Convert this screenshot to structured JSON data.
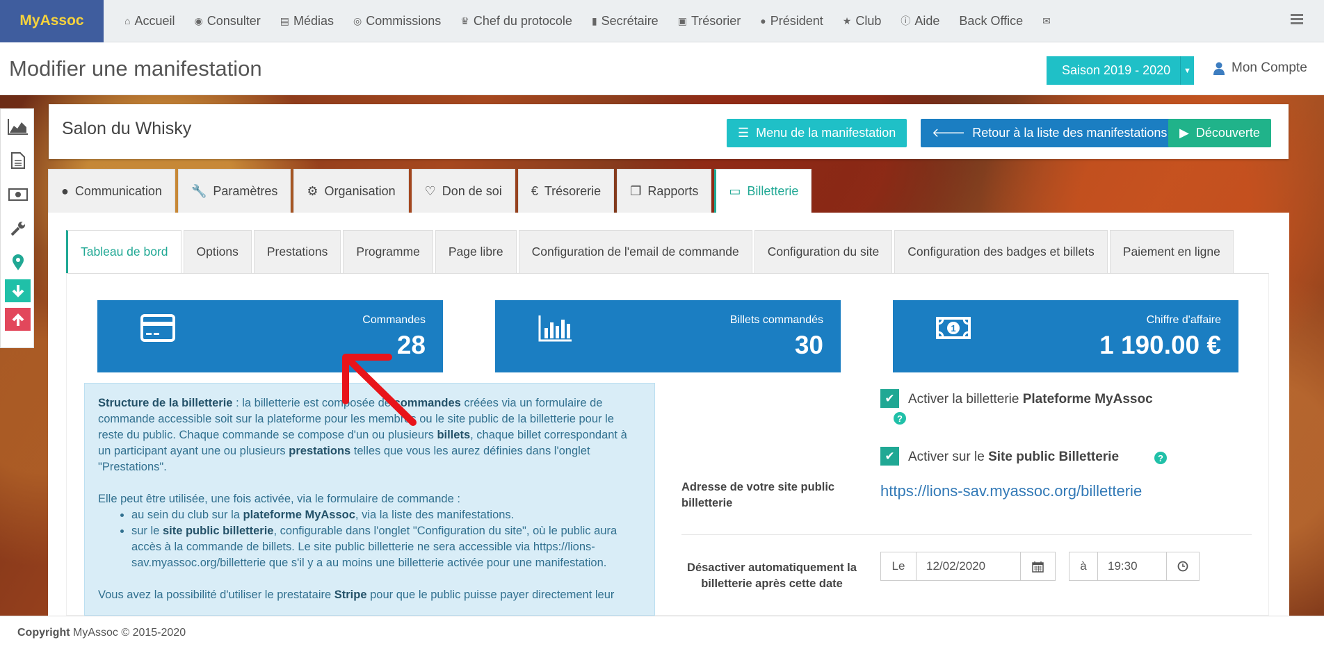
{
  "brand": "MyAssoc",
  "nav": [
    {
      "label": "Accueil",
      "icon": "home-icon",
      "glyph": "⌂"
    },
    {
      "label": "Consulter",
      "icon": "eye-icon",
      "glyph": "◉"
    },
    {
      "label": "Médias",
      "icon": "file-icon",
      "glyph": "▤"
    },
    {
      "label": "Commissions",
      "icon": "user-circle-icon",
      "glyph": "◎"
    },
    {
      "label": "Chef du protocole",
      "icon": "trophy-icon",
      "glyph": "♛"
    },
    {
      "label": "Secrétaire",
      "icon": "book-icon",
      "glyph": "▮"
    },
    {
      "label": "Trésorier",
      "icon": "money-icon",
      "glyph": "▣"
    },
    {
      "label": "Président",
      "icon": "globe-icon",
      "glyph": "●"
    },
    {
      "label": "Club",
      "icon": "star-icon",
      "glyph": "★"
    },
    {
      "label": "Aide",
      "icon": "info-icon",
      "glyph": "ⓘ"
    },
    {
      "label": "Back Office",
      "icon": "",
      "glyph": ""
    },
    {
      "label": "",
      "icon": "envelope-icon",
      "glyph": "✉"
    }
  ],
  "header": {
    "title": "Modifier une manifestation",
    "season": "Saison 2019 - 2020",
    "account": "Mon Compte"
  },
  "event": {
    "name": "Salon du Whisky",
    "btn_menu": "Menu de la manifestation",
    "btn_back": "Retour à la liste des manifestations",
    "btn_discover": "Découverte"
  },
  "main_tabs": [
    {
      "label": "Communication",
      "icon": "globe-icon",
      "glyph": "●"
    },
    {
      "label": "Paramètres",
      "icon": "wrench-icon",
      "glyph": "🔧"
    },
    {
      "label": "Organisation",
      "icon": "cogs-icon",
      "glyph": "⚙"
    },
    {
      "label": "Don de soi",
      "icon": "heart-icon",
      "glyph": "♡"
    },
    {
      "label": "Trésorerie",
      "icon": "euro-icon",
      "glyph": "€"
    },
    {
      "label": "Rapports",
      "icon": "copy-icon",
      "glyph": "❐"
    },
    {
      "label": "Billetterie",
      "icon": "credit-card-icon",
      "glyph": "▭"
    }
  ],
  "sub_tabs": [
    "Tableau de bord",
    "Options",
    "Prestations",
    "Programme",
    "Page libre",
    "Configuration de l'email de commande",
    "Configuration du site",
    "Configuration des badges et billets",
    "Paiement en ligne"
  ],
  "stats": [
    {
      "label": "Commandes",
      "value": "28",
      "icon": "credit-card-icon"
    },
    {
      "label": "Billets commandés",
      "value": "30",
      "icon": "bar-chart-icon"
    },
    {
      "label": "Chiffre d'affaire",
      "value": "1 190.00 €",
      "icon": "banknote-icon"
    }
  ],
  "info": {
    "p1_b1": "Structure de la billetterie",
    "p1_t1": " : la billetterie est composée de ",
    "p1_b2": "commandes",
    "p1_t2": " créées via un formulaire de commande accessible soit sur la plateforme pour les membres ou le site public de la billetterie pour le reste du public. Chaque commande se compose d'un ou plusieurs ",
    "p1_b3": "billets",
    "p1_t3": ", chaque billet correspondant à un participant ayant une ou plusieurs ",
    "p1_b4": "prestations",
    "p1_t4": " telles que vous les aurez définies dans l'onglet \"Prestations\".",
    "p2": "Elle peut être utilisée, une fois activée, via le formulaire de commande :",
    "li1_t1": "au sein du club sur la ",
    "li1_b": "plateforme MyAssoc",
    "li1_t2": ", via la liste des manifestations.",
    "li2_t1": "sur le ",
    "li2_b": "site public billetterie",
    "li2_t2": ", configurable dans l'onglet \"Configuration du site\", où le public aura accès à la commande de billets. Le site public billetterie ne sera accessible via ",
    "li2_link": "https://lions-sav.myassoc.org/billetterie",
    "li2_t3": " que s'il y a au moins une billetterie activée pour une manifestation.",
    "p3_t1": "Vous avez la possibilité d'utiliser le prestataire ",
    "p3_b": "Stripe",
    "p3_t2": " pour que le public puisse payer directement leur"
  },
  "options": {
    "chk1_t": "Activer la billetterie ",
    "chk1_b": "Plateforme MyAssoc",
    "chk2_t": "Activer sur le ",
    "chk2_b": "Site public Billetterie",
    "site_label": "Adresse de votre site public billetterie",
    "site_url": "https://lions-sav.myassoc.org/billetterie",
    "deact_label": "Désactiver automatiquement la billetterie après cette date",
    "le": "Le",
    "date": "12/02/2020",
    "a": "à",
    "time": "19:30"
  },
  "footer": {
    "copyright": "Copyright",
    "text": " MyAssoc © 2015-2020"
  },
  "colors": {
    "primary": "#1b7ec2",
    "teal": "#1fc0c7",
    "green": "#20a894",
    "arrow": "#e8141a"
  }
}
